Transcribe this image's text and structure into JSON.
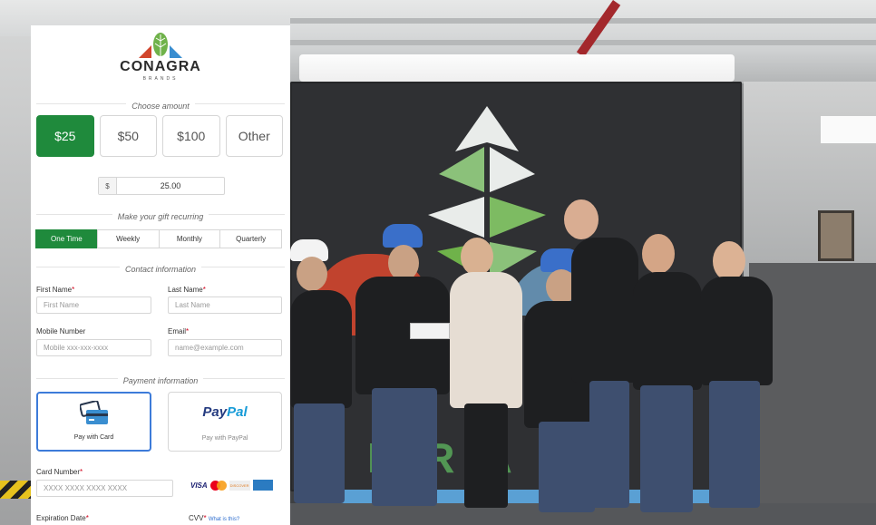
{
  "brand": {
    "name": "CONAGRA",
    "sub": "BRANDS",
    "colors": {
      "green": "#1f8a3c",
      "leaf_green": "#6fb24a",
      "red": "#d2462d",
      "blue": "#3a8ed0"
    }
  },
  "amount_section": {
    "title": "Choose amount",
    "options": [
      "$25",
      "$50",
      "$100",
      "Other"
    ],
    "selected": "$25",
    "currency_symbol": "$",
    "custom_value": "25.00"
  },
  "recurring_section": {
    "title": "Make your gift recurring",
    "options": [
      "One Time",
      "Weekly",
      "Monthly",
      "Quarterly"
    ],
    "selected": "One Time"
  },
  "contact_section": {
    "title": "Contact information",
    "first_name": {
      "label": "First Name",
      "required_mark": "*",
      "placeholder": "First Name"
    },
    "last_name": {
      "label": "Last Name",
      "required_mark": "*",
      "placeholder": "Last Name"
    },
    "mobile": {
      "label": "Mobile Number",
      "placeholder": "Mobile xxx-xxx-xxxx"
    },
    "email": {
      "label": "Email",
      "required_mark": "*",
      "placeholder": "name@example.com"
    }
  },
  "payment_section": {
    "title": "Payment information",
    "card_option": {
      "label": "Pay with Card",
      "icon": "credit-card-icon"
    },
    "paypal_option": {
      "label": "Pay with PayPal",
      "logo_p": "Pay",
      "logo_pal": "Pal"
    },
    "card_number": {
      "label": "Card Number",
      "required_mark": "*",
      "placeholder": "XXXX XXXX XXXX XXXX"
    },
    "card_brands": {
      "visa": "VISA",
      "discover": "DISCOVER"
    },
    "expiration": {
      "label": "Expiration Date",
      "required_mark": "*"
    },
    "cvv": {
      "label": "CVV",
      "required_mark": "*",
      "help_link": "What is this?"
    }
  },
  "background": {
    "banner_letters": "BRANDS"
  }
}
